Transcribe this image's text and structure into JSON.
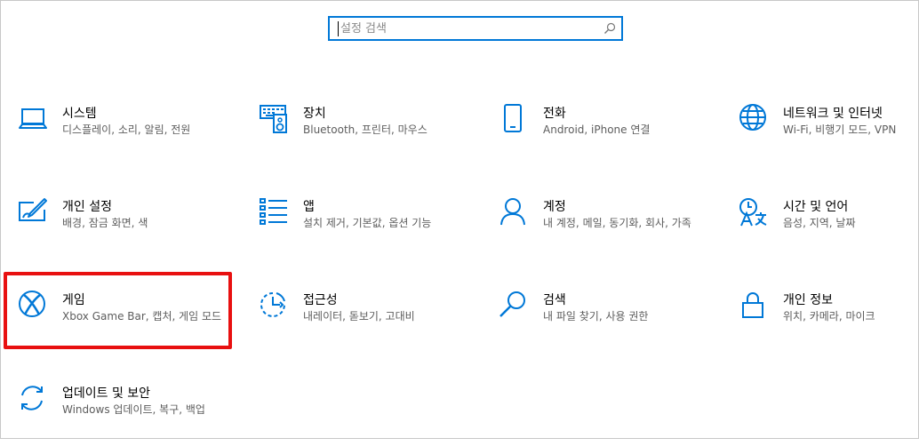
{
  "search": {
    "placeholder": "설정 검색"
  },
  "tiles": [
    {
      "title": "시스템",
      "desc": "디스플레이, 소리, 알림, 전원"
    },
    {
      "title": "장치",
      "desc": "Bluetooth, 프린터, 마우스"
    },
    {
      "title": "전화",
      "desc": "Android, iPhone 연결"
    },
    {
      "title": "네트워크 및 인터넷",
      "desc": "Wi-Fi, 비행기 모드, VPN"
    },
    {
      "title": "개인 설정",
      "desc": "배경, 잠금 화면, 색"
    },
    {
      "title": "앱",
      "desc": "설치 제거, 기본값, 옵션 기능"
    },
    {
      "title": "계정",
      "desc": "내 계정, 메일, 동기화, 회사, 가족"
    },
    {
      "title": "시간 및 언어",
      "desc": "음성, 지역, 날짜"
    },
    {
      "title": "게임",
      "desc": "Xbox Game Bar, 캡처, 게임 모드"
    },
    {
      "title": "접근성",
      "desc": "내레이터, 돋보기, 고대비"
    },
    {
      "title": "검색",
      "desc": "내 파일 찾기, 사용 권한"
    },
    {
      "title": "개인 정보",
      "desc": "위치, 카메라, 마이크"
    },
    {
      "title": "업데이트 및 보안",
      "desc": "Windows 업데이트, 복구, 백업"
    }
  ],
  "colors": {
    "accent": "#0078d7",
    "highlight": "#e81010"
  }
}
